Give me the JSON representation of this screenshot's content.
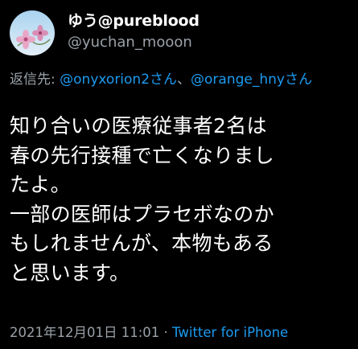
{
  "author": {
    "display_name": "ゆう@pureblood",
    "handle": "@yuchan_mooon",
    "avatar_icon": "flower-avatar-icon"
  },
  "reply": {
    "prefix": "返信先: ",
    "mention_1": "@onyxorion2さん",
    "separator": "、",
    "mention_2": "@orange_hnyさん"
  },
  "tweet": {
    "lines": [
      "知り合いの医療従事者2名は",
      "春の先行接種で亡くなりまし",
      "たよ。",
      "一部の医師はプラセボなのか",
      "もしれませんが、本物もある",
      "と思います。"
    ]
  },
  "meta": {
    "timestamp": "2021年12月01日 11:01",
    "dot": " · ",
    "source": "Twitter for iPhone"
  },
  "colors": {
    "background": "#000000",
    "link": "#1d9bf0",
    "secondary": "#9aa1a8",
    "text": "#ffffff"
  }
}
